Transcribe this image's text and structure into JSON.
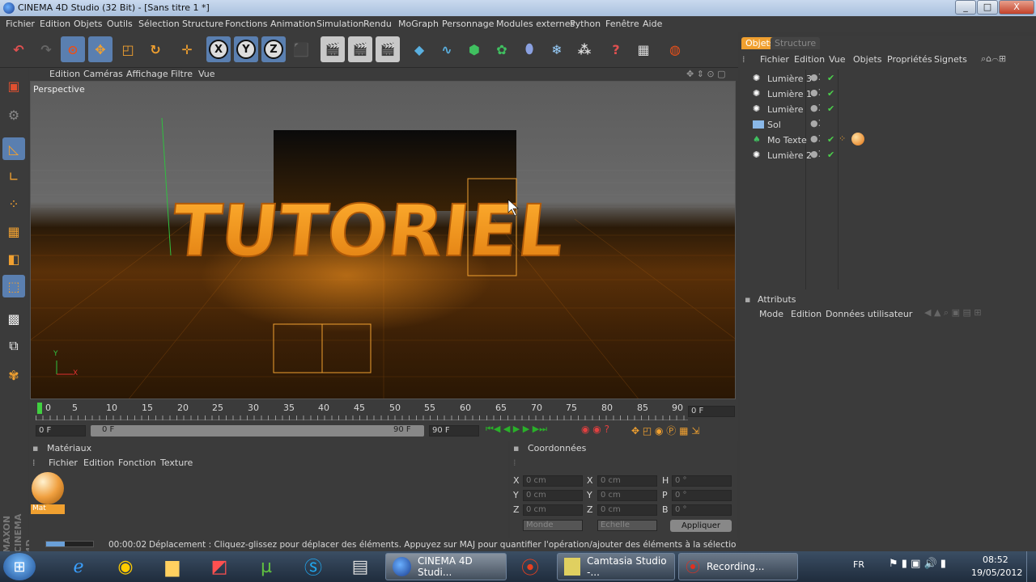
{
  "window": {
    "title": "CINEMA 4D Studio (32 Bit) - [Sans titre 1 *]",
    "controls": [
      "_",
      "□",
      "X"
    ]
  },
  "menu": [
    "Fichier",
    "Edition",
    "Objets",
    "Outils",
    "Sélection",
    "Structure",
    "Fonctions",
    "Animation",
    "Simulation",
    "Rendu",
    "MoGraph",
    "Personnage",
    "Modules externes",
    "Python",
    "Fenêtre",
    "Aide"
  ],
  "viewport": {
    "menu": [
      "Edition",
      "Caméras",
      "Affichage",
      "Filtre",
      "Vue"
    ],
    "label": "Perspective",
    "text3d": "TUTORIEL",
    "axis_y": "Y",
    "axis_x": "X"
  },
  "objects_panel": {
    "tabs": [
      "Objets",
      "Structure"
    ],
    "menu": [
      "Fichier",
      "Edition",
      "Vue",
      "Objets",
      "Propriétés",
      "Signets"
    ],
    "items": [
      {
        "name": "Lumière 3",
        "check": "✔"
      },
      {
        "name": "Lumière 1",
        "check": "✔"
      },
      {
        "name": "Lumière",
        "check": "✔"
      },
      {
        "name": "Sol",
        "check": ""
      },
      {
        "name": "Mo Texte",
        "check": "✔"
      },
      {
        "name": "Lumière 2",
        "check": "✔"
      }
    ]
  },
  "attributes_panel": {
    "title": "Attributs",
    "menu": [
      "Mode",
      "Edition",
      "Données utilisateur"
    ]
  },
  "timeline": {
    "ticks": [
      "0",
      "5",
      "10",
      "15",
      "20",
      "25",
      "30",
      "35",
      "40",
      "45",
      "50",
      "55",
      "60",
      "65",
      "70",
      "75",
      "80",
      "85",
      "90"
    ],
    "current_frame": "0 F",
    "start": "0 F",
    "range_start": "0 F",
    "range_end": "90 F",
    "end": "90 F"
  },
  "materials_panel": {
    "title": "Matériaux",
    "menu": [
      "Fichier",
      "Edition",
      "Fonction",
      "Texture"
    ],
    "material_name": "Mat"
  },
  "coords_panel": {
    "title": "Coordonnées",
    "rows": [
      {
        "a": "X",
        "av": "0 cm",
        "b": "X",
        "bv": "0 cm",
        "c": "H",
        "cv": "0 °"
      },
      {
        "a": "Y",
        "av": "0 cm",
        "b": "Y",
        "bv": "0 cm",
        "c": "P",
        "cv": "0 °"
      },
      {
        "a": "Z",
        "av": "0 cm",
        "b": "Z",
        "bv": "0 cm",
        "c": "B",
        "cv": "0 °"
      }
    ],
    "mode1": "Monde",
    "mode2": "Echelle",
    "apply": "Appliquer"
  },
  "status": {
    "time": "00:00:02",
    "message": "Déplacement : Cliquez-glissez pour déplacer des éléments. Appuyez sur MAJ pour quantifier l'opération/ajouter des éléments à la sélection en mode Points et sur CTI"
  },
  "brand": "MAXON CINEMA 4D",
  "taskbar": {
    "tasks": [
      "CINEMA 4D Studi...",
      "Camtasia Studio -...",
      "Recording..."
    ],
    "lang": "FR",
    "time": "08:52",
    "date": "19/05/2012"
  }
}
